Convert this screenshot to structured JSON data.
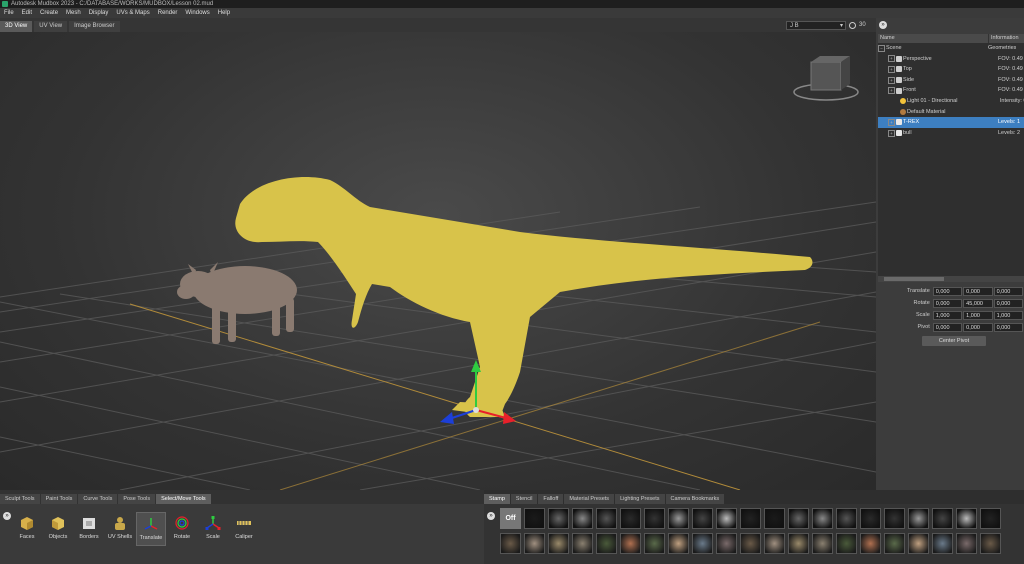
{
  "window": {
    "title": "Autodesk Mudbox 2023 - C:/DATABASE/WORKS/MUDBOX/Lesson 02.mud"
  },
  "menu": [
    "File",
    "Edit",
    "Create",
    "Mesh",
    "Display",
    "UVs & Maps",
    "Render",
    "Windows",
    "Help"
  ],
  "view_tabs": [
    {
      "label": "3D View",
      "active": true
    },
    {
      "label": "UV View",
      "active": false
    },
    {
      "label": "Image Browser",
      "active": false
    }
  ],
  "viewport": {
    "camera_selector": "J B",
    "timer": "30",
    "colors": {
      "trex": "#d8c34a",
      "bull": "#8a7a70",
      "grid": "#5a5a5a",
      "axis_x": "#b08a3a",
      "gizmo_y": "#2ecc40",
      "gizmo_x": "#e8202a",
      "gizmo_z": "#1c3fd8"
    }
  },
  "scene_panel": {
    "button": "»",
    "columns": [
      "Name",
      "Information"
    ],
    "rows": [
      {
        "name": "Scene",
        "info": "Geometries",
        "icon": "none",
        "depth": 0,
        "expand": "−",
        "selected": false
      },
      {
        "name": "Perspective",
        "info": "FOV: 0.49",
        "icon": "camera-icon",
        "depth": 1,
        "expand": "+",
        "selected": false
      },
      {
        "name": "Top",
        "info": "FOV: 0.49",
        "icon": "camera-icon",
        "depth": 1,
        "expand": "+",
        "selected": false
      },
      {
        "name": "Side",
        "info": "FOV: 0.49",
        "icon": "camera-icon",
        "depth": 1,
        "expand": "+",
        "selected": false
      },
      {
        "name": "Front",
        "info": "FOV: 0.49",
        "icon": "camera-icon",
        "depth": 1,
        "expand": "+",
        "selected": false
      },
      {
        "name": "Light 01 - Directional",
        "info": "Intensity: 0",
        "icon": "light-icon",
        "depth": 2,
        "expand": "",
        "selected": false
      },
      {
        "name": "Default Material",
        "info": "",
        "icon": "material-icon",
        "depth": 2,
        "expand": "",
        "selected": false
      },
      {
        "name": "T-REX",
        "info": "Levels: 1",
        "icon": "mesh-icon",
        "depth": 1,
        "expand": "+",
        "selected": true
      },
      {
        "name": "bull",
        "info": "Levels: 2",
        "icon": "mesh-icon",
        "depth": 1,
        "expand": "+",
        "selected": false
      }
    ]
  },
  "transform": {
    "rows": [
      {
        "label": "Translate",
        "values": [
          "0,000",
          "0,000",
          "0,000"
        ]
      },
      {
        "label": "Rotate",
        "values": [
          "0,000",
          "45,000",
          "0,000"
        ]
      },
      {
        "label": "Scale",
        "values": [
          "1,000",
          "1,000",
          "1,000"
        ]
      },
      {
        "label": "Pivot",
        "values": [
          "0,000",
          "0,000",
          "0,000"
        ]
      }
    ],
    "center_pivot_label": "Center Pivot"
  },
  "tool_panel": {
    "button": "»",
    "tabs": [
      {
        "label": "Sculpt Tools",
        "active": false
      },
      {
        "label": "Paint Tools",
        "active": false
      },
      {
        "label": "Curve Tools",
        "active": false
      },
      {
        "label": "Pose Tools",
        "active": false
      },
      {
        "label": "Select/Move Tools",
        "active": true
      }
    ],
    "tools": [
      {
        "label": "Faces",
        "icon": "faces-icon",
        "active": false
      },
      {
        "label": "Objects",
        "icon": "objects-icon",
        "active": false
      },
      {
        "label": "Borders",
        "icon": "borders-icon",
        "active": false
      },
      {
        "label": "UV Shells",
        "icon": "uv-shells-icon",
        "active": false
      },
      {
        "label": "Translate",
        "icon": "translate-icon",
        "active": true
      },
      {
        "label": "Rotate",
        "icon": "rotate-icon",
        "active": false
      },
      {
        "label": "Scale",
        "icon": "scale-icon",
        "active": false
      },
      {
        "label": "Caliper",
        "icon": "caliper-icon",
        "active": false
      }
    ]
  },
  "stamp_panel": {
    "button": "»",
    "tabs": [
      {
        "label": "Stamp",
        "active": true
      },
      {
        "label": "Stencil",
        "active": false
      },
      {
        "label": "Falloff",
        "active": false
      },
      {
        "label": "Material Presets",
        "active": false
      },
      {
        "label": "Lighting Presets",
        "active": false
      },
      {
        "label": "Camera Bookmarks",
        "active": false
      }
    ],
    "off_label": "Off"
  }
}
